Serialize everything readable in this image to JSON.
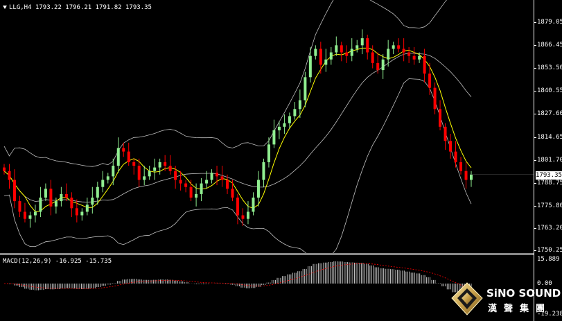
{
  "header": {
    "symbol_period": "LLG,H4",
    "ohlc": "1793.22 1796.21 1791.82 1793.35"
  },
  "macd": {
    "label": "MACD(12,26,9) -16.925 -15.735",
    "axis_top": "15.889",
    "axis_zero": "0.00",
    "axis_bottom": "-19.238"
  },
  "price_axis": {
    "ticks": [
      "1879.05",
      "1866.45",
      "1853.50",
      "1840.55",
      "1827.60",
      "1814.65",
      "1801.70",
      "1788.75",
      "1775.80",
      "1763.20",
      "1750.25"
    ],
    "current_price": "1793.35"
  },
  "colors": {
    "bull": "#90ee90",
    "bear": "#ff0000",
    "bands": "#c0c0c0",
    "ma": "#ffff00",
    "macd_hist": "#c0c0c0",
    "macd_signal": "#ff0000"
  },
  "logo": {
    "name": "SiNO SOUND",
    "chinese": "漢聲集團",
    "icon": "diamond-logo-icon"
  },
  "chart_data": {
    "type": "candlestick",
    "ylim": [
      1750.25,
      1879.05
    ],
    "candles_approx_close": [
      1795,
      1790,
      1778,
      1772,
      1768,
      1770,
      1772,
      1780,
      1785,
      1775,
      1778,
      1782,
      1780,
      1774,
      1770,
      1772,
      1776,
      1780,
      1786,
      1790,
      1792,
      1798,
      1808,
      1806,
      1800,
      1798,
      1790,
      1792,
      1795,
      1797,
      1800,
      1798,
      1795,
      1790,
      1788,
      1786,
      1780,
      1782,
      1788,
      1790,
      1794,
      1792,
      1790,
      1785,
      1780,
      1770,
      1768,
      1772,
      1780,
      1790,
      1800,
      1810,
      1818,
      1820,
      1822,
      1826,
      1830,
      1835,
      1848,
      1860,
      1864,
      1855,
      1858,
      1862,
      1866,
      1862,
      1860,
      1864,
      1866,
      1870,
      1862,
      1856,
      1852,
      1858,
      1864,
      1866,
      1864,
      1862,
      1860,
      1858,
      1860,
      1850,
      1842,
      1830,
      1820,
      1812,
      1806,
      1800,
      1795,
      1790,
      1793
    ]
  }
}
